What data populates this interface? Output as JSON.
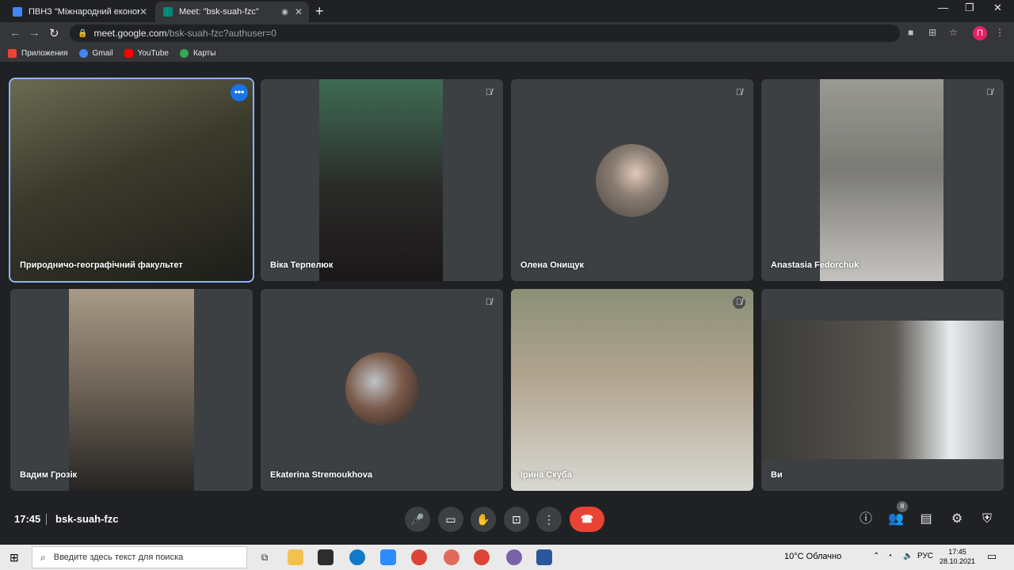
{
  "tabs": [
    {
      "title": "ПВНЗ \"Міжнародний економіко-",
      "close": "✕"
    },
    {
      "title": "Meet: \"bsk-suah-fzc\"",
      "close": "✕"
    }
  ],
  "new_tab": "+",
  "window_controls": {
    "minimize": "—",
    "maximize": "❐",
    "close": "✕"
  },
  "address": {
    "host": "meet.google.com",
    "path": "/bsk-suah-fzc?authuser=0"
  },
  "profile_initial": "П",
  "bookmarks": [
    {
      "label": "Приложения",
      "icon": "apps-grid-icon",
      "color": "#ea4335"
    },
    {
      "label": "Gmail",
      "icon": "google-icon",
      "color": "#4285f4"
    },
    {
      "label": "YouTube",
      "icon": "youtube-icon",
      "color": "#ff0000"
    },
    {
      "label": "Карты",
      "icon": "maps-icon",
      "color": "#34a853"
    }
  ],
  "participants": [
    {
      "name": "Природничо-географічний факультет",
      "muted": false,
      "selected": true
    },
    {
      "name": "Віка Терпелюк",
      "muted": true
    },
    {
      "name": "Олена Онищук",
      "muted": true,
      "avatar": true
    },
    {
      "name": "Anastasia Fedorchuk",
      "muted": true
    },
    {
      "name": "Вадим Грозік",
      "muted": false
    },
    {
      "name": "Ekaterina Stremoukhova",
      "muted": true,
      "avatar": true
    },
    {
      "name": "Ірина Скуба",
      "muted": true
    },
    {
      "name": "Ви",
      "muted": false
    }
  ],
  "meeting": {
    "time": "17:45",
    "code": "bsk-suah-fzc",
    "participant_count": "8"
  },
  "controls": {
    "end_call_icon": "phone-hangup-icon"
  },
  "taskbar": {
    "search_placeholder": "Введите здесь текст для поиска",
    "weather": "10°C  Облачно",
    "lang": "РУС",
    "time": "17:45",
    "date": "28.10.2021"
  }
}
